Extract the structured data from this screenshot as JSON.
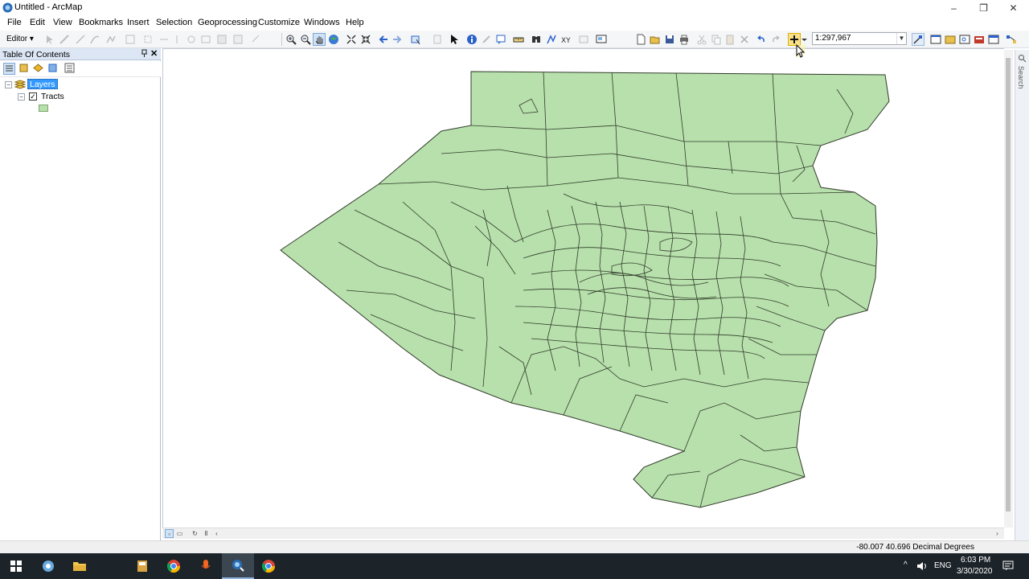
{
  "window": {
    "title": "Untitled - ArcMap",
    "minimize": "–",
    "restore": "❐",
    "close": "✕"
  },
  "menu": [
    "File",
    "Edit",
    "View",
    "Bookmarks",
    "Insert",
    "Selection",
    "Geoprocessing",
    "Customize",
    "Windows",
    "Help"
  ],
  "toolbar": {
    "editor_label": "Editor ▾",
    "scale_value": "1:297,967",
    "scale_dropdown": "▼",
    "tools": [
      "zoom-in-icon",
      "zoom-out-icon",
      "pan-icon",
      "full-extent-icon",
      "fixed-zoom-in-icon",
      "fixed-zoom-out-icon",
      "back-icon",
      "forward-icon",
      "select-features-icon",
      "select-elements-icon",
      "identify-icon",
      "html-popup-icon",
      "measure-icon",
      "find-icon",
      "go-to-xy-icon",
      "time-slider-icon",
      "new-document-icon",
      "open-icon",
      "save-icon",
      "print-icon",
      "cut-icon",
      "copy-icon",
      "paste-icon",
      "delete-icon",
      "undo-icon",
      "redo-icon",
      "add-data-icon"
    ],
    "accent": "#d9b200"
  },
  "toc": {
    "title": "Table Of Contents",
    "pin": "📌",
    "close": "✕",
    "layers_label": "Layers",
    "layer_name": "Tracts",
    "layer_checked": "✓",
    "expander_collapse": "−",
    "swatch_color": "#b8e0ac"
  },
  "map": {
    "fill": "#b8e0ac",
    "stroke": "#2f3b2a",
    "layer": "Tracts"
  },
  "search_tab": "Search",
  "status": {
    "coordinates": "-80.007  40.696 Decimal Degrees"
  },
  "taskbar": {
    "language": "ENG",
    "time": "6:03 PM",
    "date": "3/30/2020",
    "caret": "^"
  }
}
